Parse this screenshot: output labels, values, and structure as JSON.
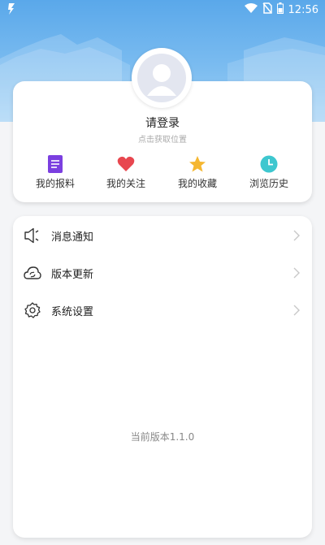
{
  "status_bar": {
    "time": "12:56",
    "left_icon": "app-notification-icon",
    "right_icons": [
      "wifi-icon",
      "no-sim-icon",
      "battery-icon"
    ]
  },
  "profile": {
    "title": "请登录",
    "subtitle": "点击获取位置",
    "avatar_icon": "default-avatar-icon"
  },
  "quick_actions": [
    {
      "label": "我的报料",
      "icon": "document-icon",
      "color": "#7b3fe0"
    },
    {
      "label": "我的关注",
      "icon": "heart-icon",
      "color": "#e8474f"
    },
    {
      "label": "我的收藏",
      "icon": "star-icon",
      "color": "#f5b731"
    },
    {
      "label": "浏览历史",
      "icon": "clock-icon",
      "color": "#3ec7cf"
    }
  ],
  "menu": [
    {
      "label": "消息通知",
      "icon": "speaker-icon"
    },
    {
      "label": "版本更新",
      "icon": "cloud-sync-icon"
    },
    {
      "label": "系统设置",
      "icon": "gear-icon"
    }
  ],
  "version_text": "当前版本1.1.0",
  "colors": {
    "header_top": "#5aa8ea",
    "header_bottom": "#9fd0f5"
  }
}
